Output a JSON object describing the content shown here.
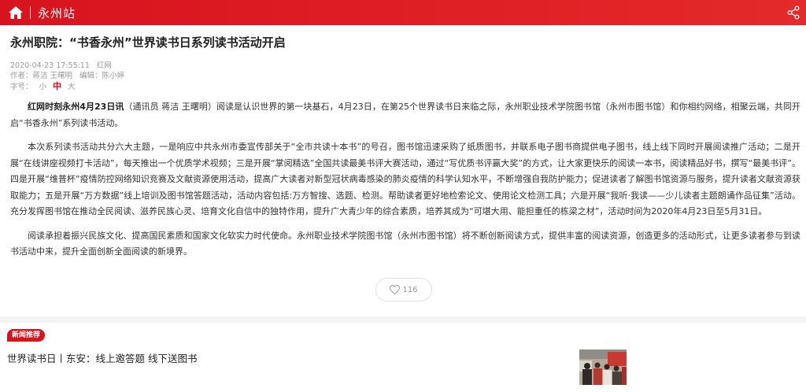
{
  "header": {
    "site_name": "永州站"
  },
  "article": {
    "title": "永州职院：“书香永州”世界读书日系列读书活动开启",
    "datetime": "2020-04-23 17:55:11",
    "source": "红网",
    "authors_label": "作者：",
    "authors": "蒋洁 王曙明",
    "editor_label": "编辑：",
    "editor": "陈小婷",
    "font_size_label": "字号：",
    "font_sizes": [
      "小",
      "中",
      "大"
    ],
    "lead": "红网时刻永州4月23日讯",
    "para1_rest": "（通讯员 蒋洁 王曙明）阅读是认识世界的第一块基石，4月23日，在第25个世界读书日来临之际，永州职业技术学院图书馆（永州市图书馆）和你相约网络，相聚云端，共同开启“书香永州”系列读书活动。",
    "para2": "本次系列读书活动共分六大主题，一是响应中共永州市委宣传部关于“全市共读十本书”的号召，图书馆迅速采购了纸质图书，并联系电子图书商提供电子图书，线上线下同时开展阅读推广活动；二是开展“在线讲座视频打卡活动”，每天推出一个优质学术视频；三是开展“掌阅精选”全国共读最美书评大赛活动，通过“写优质书评赢大奖”的方式，让大家更快乐的阅读一本书，阅读精品好书，撰写“最美书评”。四是开展“维普杯”疫情防控网络知识竞赛及文献资源使用活动，提高广大读者对新型冠状病毒感染的肺炎疫情的科学认知水平，不断增强自我防护能力；促进读者了解图书馆资源与服务，提升读者文献资源获取能力；五是开展“万方数据”线上培训及图书馆答题活动，活动内容包括:万方智搜、选题、检测。帮助读者更好地检索论文、使用论文检测工具；六是开展“我听·我读——少儿读者主题朗诵作品征集”活动。充分发挥图书馆在推动全民阅读、滋养民族心灵、培育文化自信中的独特作用，提升广大青少年的综合素质，培养其成为“可堪大用、能担重任的栋梁之材”，活动时间为2020年4月23日至5月31日。",
    "para3": "阅读承担着振兴民族文化、提高国民素质和国家文化软实力时代使命。永州职业技术学院图书馆（永州市图书馆）将不断创新阅读方式，提供丰富的阅读资源，创造更多的活动形式，让更多读者参与到读书活动中来，提升全面创新全面阅读的新境界。",
    "like_count": "116"
  },
  "recommend": {
    "badge": "新闻推荐",
    "title": "世界读书日丨东安：线上邀答题 线下送图书"
  },
  "colors": {
    "brand_red": "#d8131e",
    "meta_gray": "#999999"
  },
  "icons": {
    "home": "home-icon",
    "share": "share-icon",
    "like": "heart-icon"
  }
}
